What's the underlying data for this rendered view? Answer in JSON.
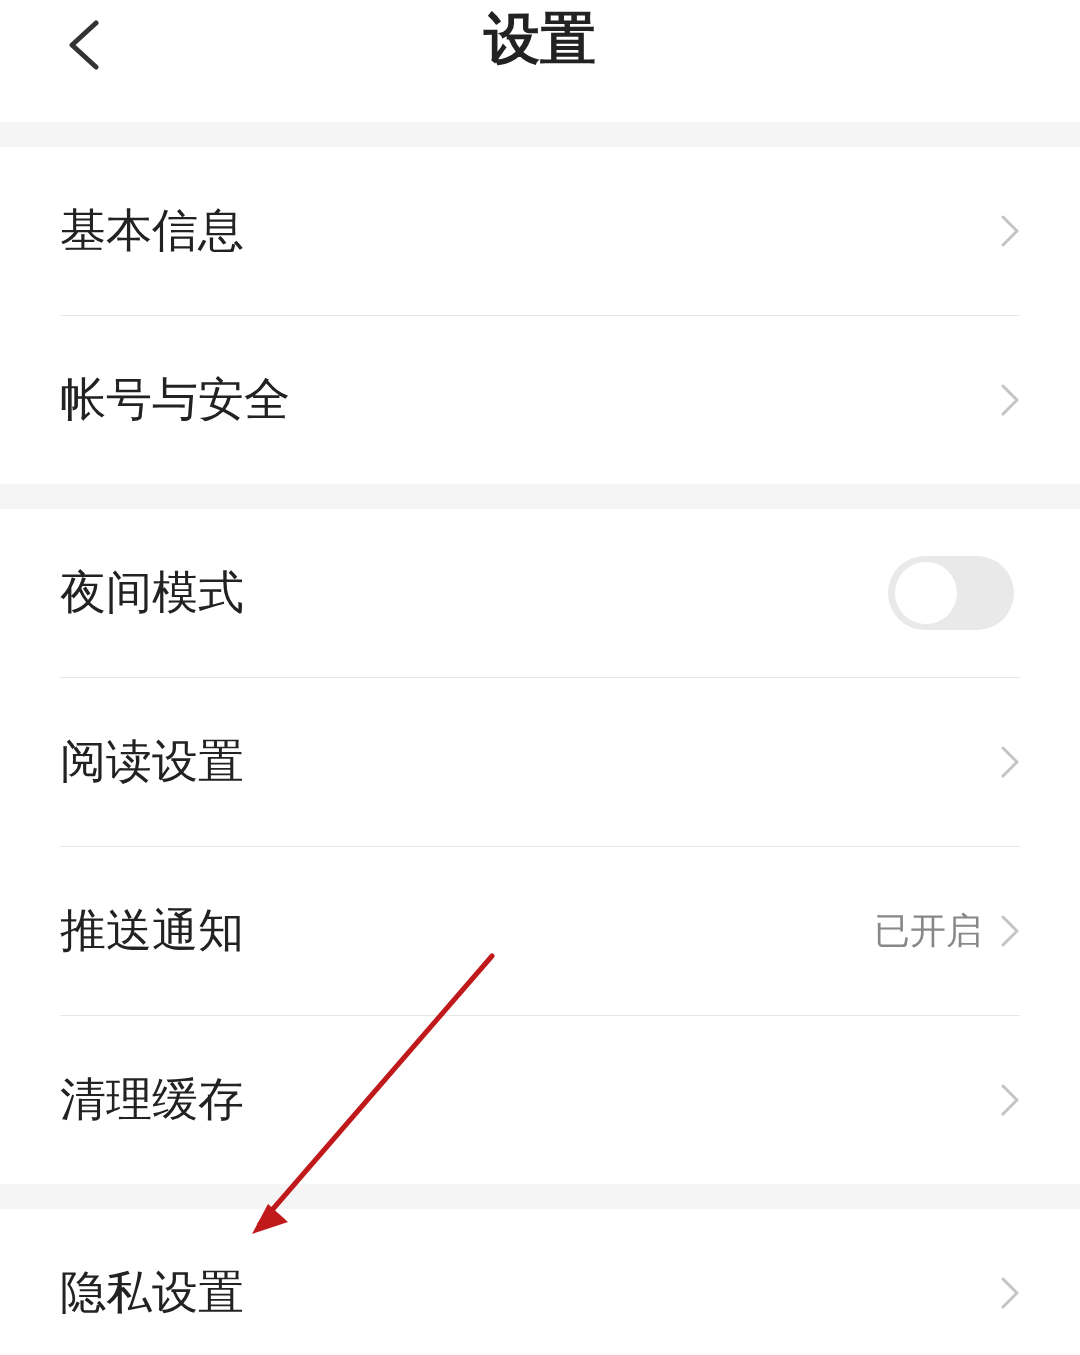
{
  "header": {
    "title": "设置"
  },
  "sections": [
    {
      "items": [
        {
          "kind": "link",
          "label": "基本信息"
        },
        {
          "kind": "link",
          "label": "帐号与安全"
        }
      ]
    },
    {
      "items": [
        {
          "kind": "toggle",
          "label": "夜间模式",
          "on": false
        },
        {
          "kind": "link",
          "label": "阅读设置"
        },
        {
          "kind": "link",
          "label": "推送通知",
          "value": "已开启"
        },
        {
          "kind": "link",
          "label": "清理缓存"
        }
      ]
    },
    {
      "items": [
        {
          "kind": "link",
          "label": "隐私设置"
        }
      ]
    }
  ],
  "annotation": {
    "kind": "arrow"
  }
}
